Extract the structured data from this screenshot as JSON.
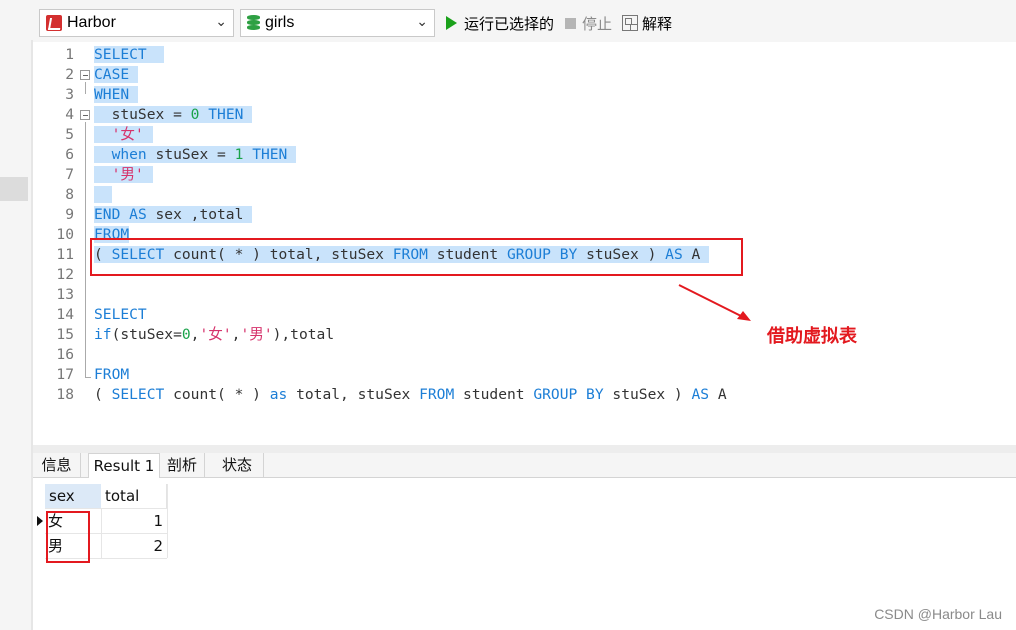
{
  "toolbar": {
    "connection": "Harbor",
    "database": "girls",
    "run_selected": "运行已选择的",
    "stop": "停止",
    "explain": "解释"
  },
  "editor": {
    "lines": [
      {
        "n": "1"
      },
      {
        "n": "2"
      },
      {
        "n": "3"
      },
      {
        "n": "4"
      },
      {
        "n": "5"
      },
      {
        "n": "6"
      },
      {
        "n": "7"
      },
      {
        "n": "8"
      },
      {
        "n": "9"
      },
      {
        "n": "10"
      },
      {
        "n": "11"
      },
      {
        "n": "12"
      },
      {
        "n": "13"
      },
      {
        "n": "14"
      },
      {
        "n": "15"
      },
      {
        "n": "16"
      },
      {
        "n": "17"
      },
      {
        "n": "18"
      }
    ],
    "tokens": {
      "select": "SELECT",
      "case": "CASE",
      "when": "WHEN",
      "stusex": "stuSex",
      "eq": " = ",
      "zero": "0",
      "one": "1",
      "then": "THEN",
      "nv": "'女'",
      "nan": "'男'",
      "when_lower": "when",
      "end": "END",
      "as": "AS",
      "sex_total": " sex ,total",
      "from": "FROM",
      "lparen": "( ",
      "count": " count( * ) total, stuSex ",
      "student": " student ",
      "group_by": "GROUP BY",
      "stusex_close": " stuSex ) ",
      "a": " A",
      "if_open": "if(stuSex=",
      "comma": ",",
      "if_close": "),total",
      "count2": " count( * ) ",
      "as_lower": "as",
      "total_stusex": " total, stuSex "
    }
  },
  "annotation": {
    "label": "借助虚拟表"
  },
  "tabs": [
    {
      "label": "信息"
    },
    {
      "label": "Result 1"
    },
    {
      "label": "剖析"
    },
    {
      "label": "状态"
    }
  ],
  "results": {
    "columns": [
      "sex",
      "total"
    ],
    "rows": [
      {
        "sex": "女",
        "total": "1"
      },
      {
        "sex": "男",
        "total": "2"
      }
    ]
  },
  "watermark": "CSDN @Harbor Lau"
}
